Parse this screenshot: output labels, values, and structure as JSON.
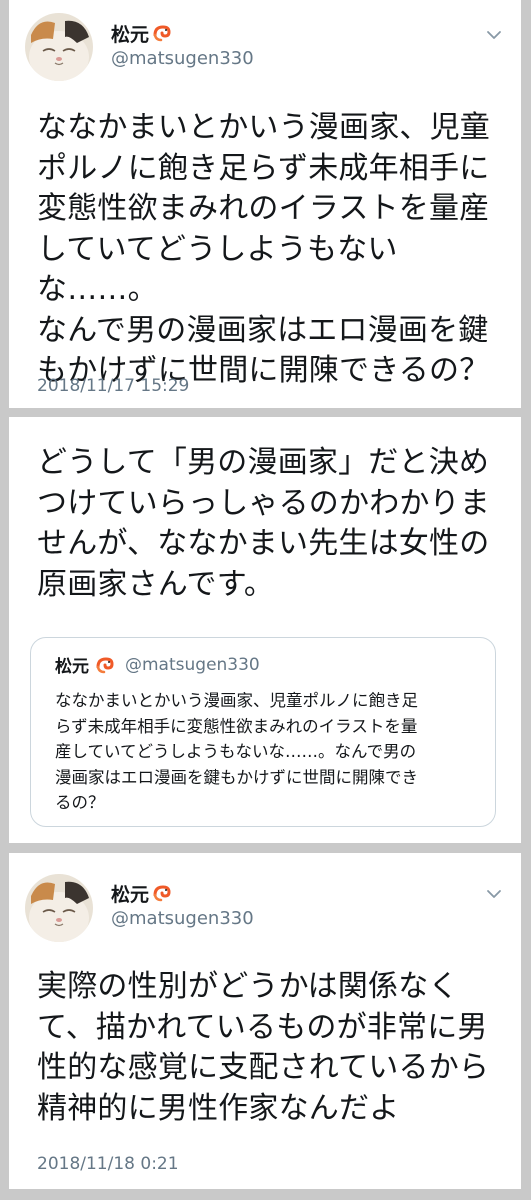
{
  "tweets": [
    {
      "author_name": "松元",
      "author_handle": "@matsugen330",
      "text": "ななかまいとかいう漫画家、児童\nポルノに飽き足らず未成年相手に\n変態性欲まみれのイラストを量産\nしていてどうしようもないな……。\nなんで男の漫画家はエロ漫画を鍵\nもかけずに世間に開陳できるの？",
      "timestamp": "2018/11/17 15:29"
    },
    {
      "text": "どうして「男の漫画家」だと決め\nつけていらっしゃるのかわかりま\nせんが、ななかまい先生は女性の\n原画家さんです。",
      "quoted": {
        "author_name": "松元",
        "author_handle": "@matsugen330",
        "text": "ななかまいとかいう漫画家、児童ポルノに飽き足\nらず未成年相手に変態性欲まみれのイラストを量\n産していてどうしようもないな……。なんで男の\n漫画家はエロ漫画を鍵もかけずに世間に開陳でき\nるの？"
      }
    },
    {
      "author_name": "松元",
      "author_handle": "@matsugen330",
      "text": "実際の性別がどうかは関係なく\nて、描かれているものが非常に男\n性的な感覚に支配されているから\n精神的に男性作家なんだよ",
      "timestamp": "2018/11/18 0:21"
    }
  ],
  "icons": {
    "name_badge": "shrimp-emoji-icon",
    "menu": "chevron-down-icon"
  },
  "colors": {
    "text_primary": "#14171a",
    "text_secondary": "#657786",
    "border": "#ccd6dd",
    "page_background": "#c9c9c9",
    "card_background": "#ffffff"
  }
}
